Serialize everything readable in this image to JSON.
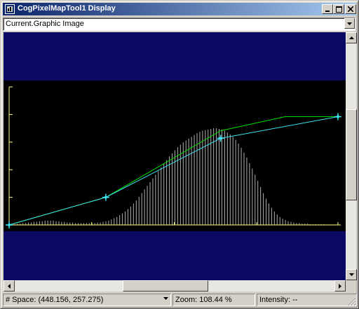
{
  "window": {
    "title": "CogPixelMapTool1 Display",
    "controls": [
      "minimize",
      "maximize",
      "close"
    ]
  },
  "image_selector": {
    "selected": "Current.Graphic Image"
  },
  "statusbar": {
    "space": "# Space: (448.156, 257.275)",
    "zoom": "Zoom: 108.44 %",
    "intensity": "Intensity: --"
  },
  "colors": {
    "background": "#0a0a64",
    "plot_background": "#000000",
    "axis": "#ffff80",
    "histogram": "#b0b0b0",
    "green_curve": "#00e000",
    "cyan_curve": "#40e0f0"
  },
  "chart_data": {
    "type": "line",
    "title": "",
    "xlabel": "",
    "ylabel": "",
    "xlim": [
      0,
      255
    ],
    "ylim": [
      0,
      255
    ],
    "grid": false,
    "series": [
      {
        "x": [
          0,
          75,
          164,
          214,
          255
        ],
        "y": [
          0,
          51,
          174,
          200,
          200
        ],
        "color": "#00e000"
      },
      {
        "x": [
          0,
          75,
          164,
          255
        ],
        "y": [
          0,
          51,
          160,
          200
        ],
        "color": "#40e0f0",
        "control_points": true
      }
    ],
    "histogram": {
      "x_range": [
        0,
        255
      ],
      "values": [
        0,
        1,
        1,
        2,
        2,
        3,
        3,
        4,
        4,
        5,
        5,
        6,
        6,
        7,
        7,
        7,
        7,
        6,
        6,
        5,
        5,
        4,
        4,
        4,
        3,
        3,
        3,
        3,
        3,
        3,
        3,
        3,
        4,
        4,
        5,
        6,
        7,
        9,
        11,
        13,
        16,
        19,
        22,
        26,
        30,
        35,
        40,
        46,
        52,
        58,
        64,
        70,
        76,
        82,
        88,
        94,
        100,
        106,
        112,
        117,
        122,
        127,
        131,
        135,
        138,
        141,
        144,
        147,
        150,
        152,
        154,
        155,
        156,
        157,
        158,
        158,
        157,
        156,
        154,
        151,
        148,
        144,
        139,
        133,
        126,
        118,
        110,
        101,
        92,
        82,
        72,
        62,
        52,
        43,
        35,
        28,
        22,
        17,
        13,
        10,
        8,
        6,
        5,
        4,
        3,
        3,
        2,
        2,
        2,
        1,
        1,
        1,
        1,
        1,
        1,
        0,
        0,
        0,
        0,
        0
      ]
    }
  }
}
